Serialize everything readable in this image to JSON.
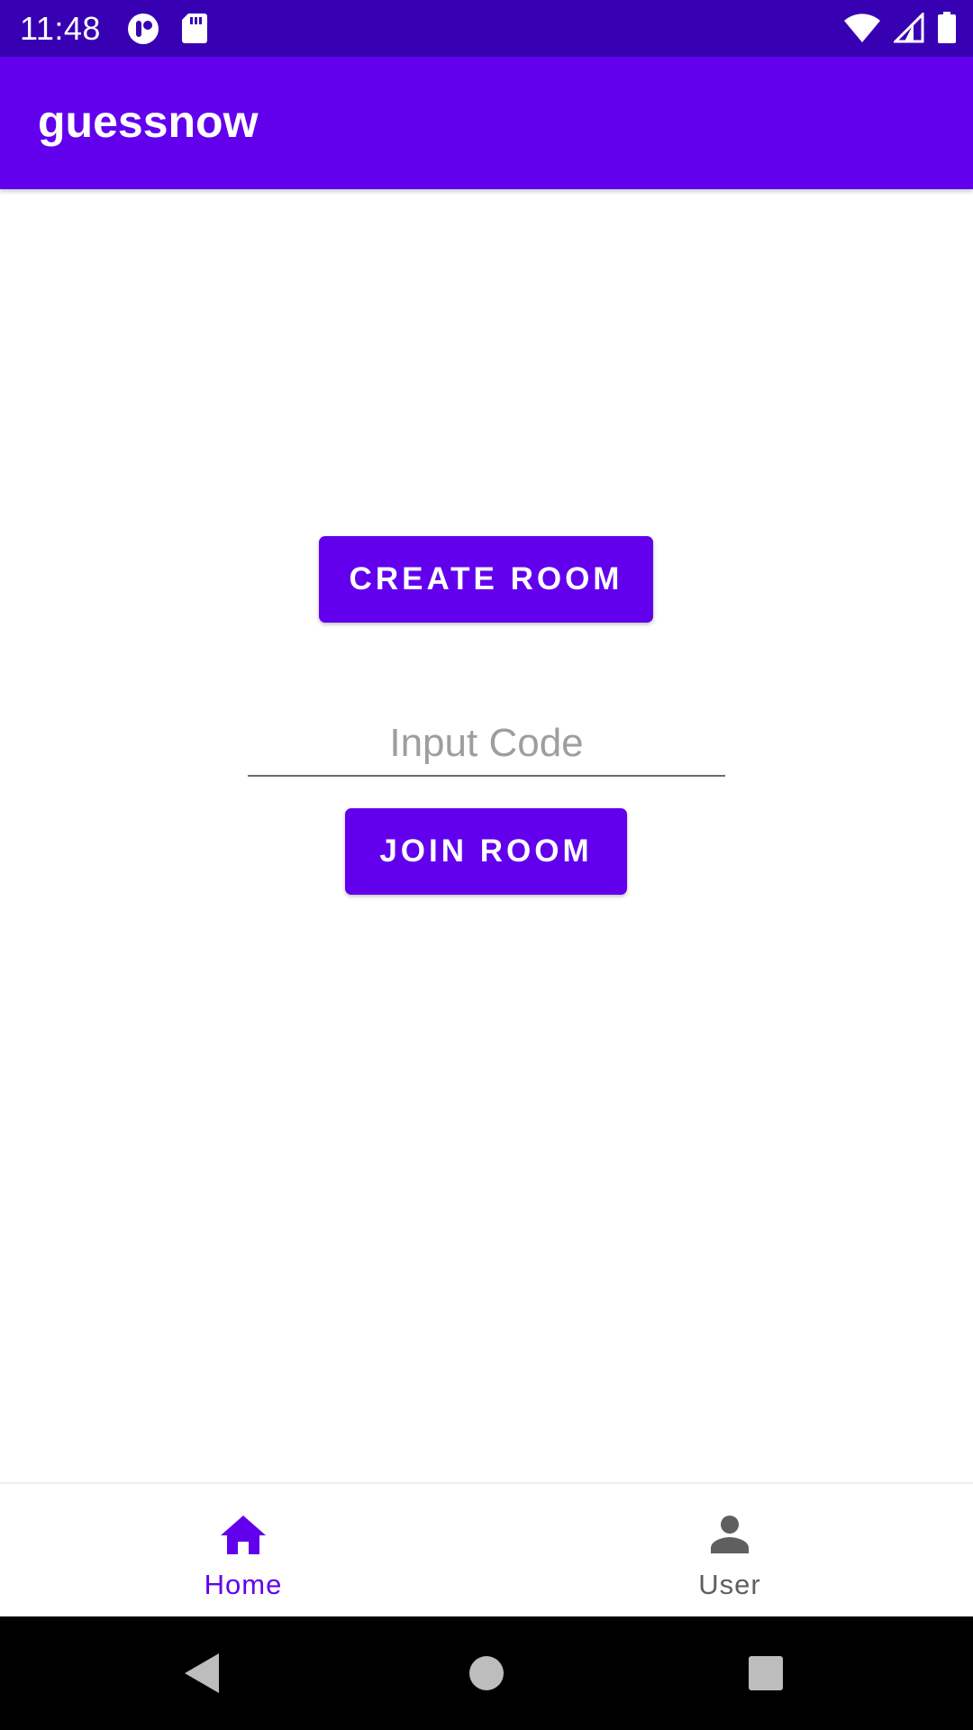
{
  "status_bar": {
    "time": "11:48",
    "left_icons": [
      "notification-app-icon",
      "sd-card-icon"
    ],
    "right_icons": [
      "wifi-icon",
      "cell-signal-icon",
      "battery-icon"
    ],
    "background": "#3700b3"
  },
  "app_bar": {
    "title": "guessnow",
    "background": "#6200ee"
  },
  "main": {
    "create_room_label": "CREATE ROOM",
    "code_input": {
      "placeholder": "Input Code",
      "value": ""
    },
    "join_room_label": "JOIN ROOM",
    "accent_color": "#6200ee"
  },
  "bottom_nav": {
    "items": [
      {
        "label": "Home",
        "icon": "home-icon",
        "selected": true
      },
      {
        "label": "User",
        "icon": "person-icon",
        "selected": false
      }
    ],
    "selected_color": "#6200ee",
    "unselected_color": "#5f5f5f"
  },
  "system_nav": {
    "buttons": [
      "back-icon",
      "home-circle-icon",
      "recents-icon"
    ]
  }
}
